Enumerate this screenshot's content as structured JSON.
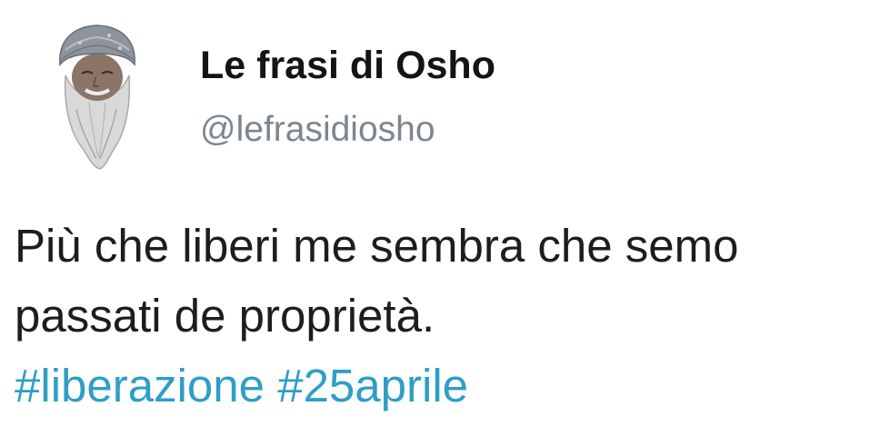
{
  "profile": {
    "display_name": "Le frasi di Osho",
    "handle": "@lefrasidiosho",
    "avatar_icon": "user-avatar-icon"
  },
  "tweet": {
    "lines": [
      "Più che liberi me sembra che semo",
      "passati de proprietà."
    ],
    "hashtags": [
      "#liberazione",
      "#25aprile"
    ]
  },
  "colors": {
    "text": "#1d1d1d",
    "name": "#141414",
    "handle": "#7c8690",
    "hashtag": "#2f9ec7",
    "background": "#ffffff"
  }
}
